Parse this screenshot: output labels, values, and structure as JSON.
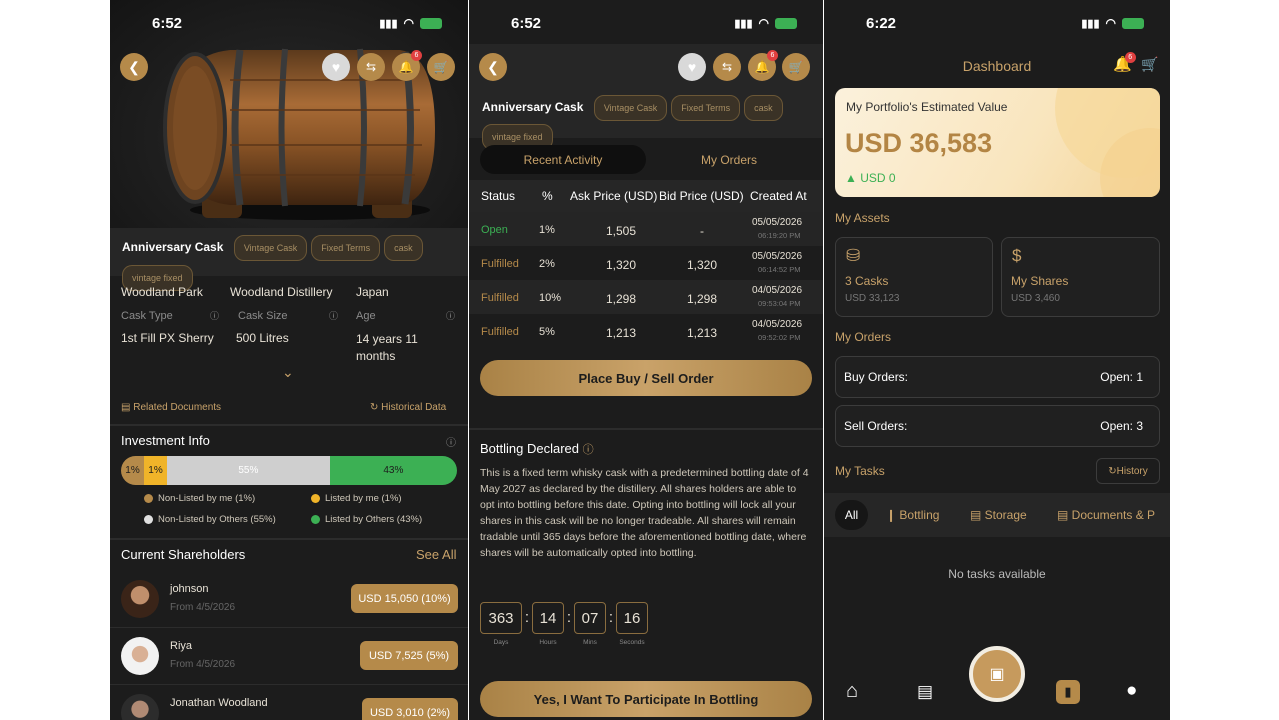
{
  "status": {
    "s1": {
      "time": "6:52"
    },
    "s2": {
      "time": "6:52"
    },
    "s3": {
      "time": "6:22"
    }
  },
  "colors": {
    "gold": "#b58a4a",
    "green": "#3cb054",
    "yellow": "#f0b429",
    "dark": "#1c1c1c"
  },
  "notification_count": "6",
  "detail": {
    "cask_name": "Anniversary Cask",
    "tags": [
      "Vintage Cask",
      "Fixed Terms",
      "cask",
      "vintage fixed"
    ],
    "location": [
      "Woodland Park",
      "Woodland Distillery",
      "Japan"
    ],
    "specs": [
      {
        "label": "Cask Type",
        "value": "1st Fill PX Sherry"
      },
      {
        "label": "Cask Size",
        "value": "500 Litres"
      },
      {
        "label": "Age",
        "value": "14 years 11 months"
      }
    ],
    "related_docs": "Related Documents",
    "historical": "Historical Data",
    "investment_title": "Investment Info",
    "bar": [
      {
        "label": "1%",
        "value": 1,
        "color": "#b58a4a"
      },
      {
        "label": "1%",
        "value": 1,
        "color": "#f0b429"
      },
      {
        "label": "55%",
        "value": 55,
        "color": "#cfcfcf"
      },
      {
        "label": "43%",
        "value": 43,
        "color": "#3cb054"
      }
    ],
    "legend": [
      {
        "text": "Non-Listed by me (1%)",
        "color": "#b58a4a"
      },
      {
        "text": "Listed by me (1%)",
        "color": "#f0b429"
      },
      {
        "text": "Non-Listed by Others (55%)",
        "color": "#e0e0e0"
      },
      {
        "text": "Listed by Others (43%)",
        "color": "#3cb054"
      }
    ],
    "shareholders_title": "Current Shareholders",
    "see_all": "See All",
    "shareholders": [
      {
        "name": "johnson",
        "date": "From 4/5/2026",
        "value": "USD 15,050 (10%)"
      },
      {
        "name": "Riya",
        "date": "From 4/5/2026",
        "value": "USD 7,525 (5%)"
      },
      {
        "name": "Jonathan Woodland",
        "date": "",
        "value": "USD 3,010 (2%)"
      }
    ]
  },
  "orders": {
    "cask_name": "Anniversary Cask",
    "tags": [
      "Vintage Cask",
      "Fixed Terms",
      "cask",
      "vintage fixed"
    ],
    "tab_active": "Recent Activity",
    "tab_inactive": "My Orders",
    "headers": [
      "Status",
      "%",
      "Ask Price (USD)",
      "Bid Price (USD)",
      "Created At"
    ],
    "rows": [
      {
        "status": "Open",
        "pct": "1%",
        "ask": "1,505",
        "bid": "-",
        "date": "05/05/2026",
        "time": "06:19:20 PM"
      },
      {
        "status": "Fulfilled",
        "pct": "2%",
        "ask": "1,320",
        "bid": "1,320",
        "date": "05/05/2026",
        "time": "06:14:52 PM"
      },
      {
        "status": "Fulfilled",
        "pct": "10%",
        "ask": "1,298",
        "bid": "1,298",
        "date": "04/05/2026",
        "time": "09:53:04 PM"
      },
      {
        "status": "Fulfilled",
        "pct": "5%",
        "ask": "1,213",
        "bid": "1,213",
        "date": "04/05/2026",
        "time": "09:52:02 PM"
      }
    ],
    "place_order": "Place Buy / Sell Order",
    "bottling_title": "Bottling Declared",
    "bottling_text": "This is a fixed term whisky cask with a predetermined bottling date of 4 May 2027 as declared by the distillery. All shares holders are able to opt into bottling before this date. Opting into bottling will lock all your shares in this cask will be no longer tradeable. All shares will remain tradable until 365 days before the aforementioned bottling date, where shares will be automatically opted into bottling.",
    "countdown": [
      {
        "value": "363",
        "unit": "Days"
      },
      {
        "value": "14",
        "unit": "Hours"
      },
      {
        "value": "07",
        "unit": "Mins"
      },
      {
        "value": "16",
        "unit": "Seconds"
      }
    ],
    "participate": "Yes, I Want To Participate In Bottling"
  },
  "dashboard": {
    "title": "Dashboard",
    "portfolio_label": "My Portfolio's Estimated Value",
    "portfolio_value": "USD 36,583",
    "portfolio_change": "USD 0",
    "assets_title": "My Assets",
    "assets": [
      {
        "title": "3 Casks",
        "sub": "USD 33,123"
      },
      {
        "title": "My Shares",
        "sub": "USD 3,460"
      }
    ],
    "orders_title": "My Orders",
    "orders": [
      {
        "label": "Buy Orders:",
        "value": "Open: 1"
      },
      {
        "label": "Sell Orders:",
        "value": "Open: 3"
      }
    ],
    "tasks_title": "My Tasks",
    "history": "History",
    "task_tabs": [
      "All",
      "Bottling",
      "Storage",
      "Documents & P"
    ],
    "no_tasks": "No tasks available",
    "nav": [
      "home-icon",
      "news-icon",
      "store-icon",
      "portfolio-icon",
      "profile-icon"
    ]
  }
}
